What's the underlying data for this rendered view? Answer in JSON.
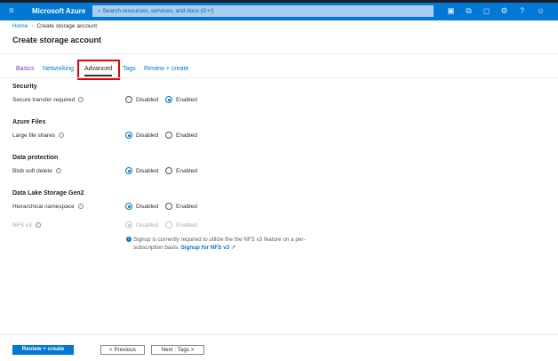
{
  "header": {
    "brand": "Microsoft Azure",
    "search_placeholder": "Search resources, services, and docs (G+/)",
    "icons": [
      "cloud-shell-icon",
      "directory-filter-icon",
      "notifications-icon",
      "settings-icon",
      "help-icon",
      "feedback-icon"
    ]
  },
  "breadcrumb": {
    "home": "Home",
    "current": "Create storage account"
  },
  "page_title": "Create storage account",
  "tabs": [
    {
      "label": "Basics"
    },
    {
      "label": "Networking"
    },
    {
      "label": "Advanced",
      "active": true
    },
    {
      "label": "Tags"
    },
    {
      "label": "Review + create"
    }
  ],
  "sections": {
    "security": {
      "title": "Security",
      "label": "Secure transfer required",
      "selected": "Enabled"
    },
    "azure_files": {
      "title": "Azure Files",
      "label": "Large file shares",
      "selected": "Disabled"
    },
    "data_protection": {
      "title": "Data protection",
      "label": "Blob soft delete",
      "selected": "Disabled"
    },
    "data_lake": {
      "title": "Data Lake Storage Gen2",
      "label": "Hierarchical namespace",
      "selected": "Disabled",
      "nfs_label": "NFS v3",
      "nfs_selected": "Disabled"
    }
  },
  "options": {
    "disabled": "Disabled",
    "enabled": "Enabled"
  },
  "note": {
    "text": "Signup is currently required to utilize the the NFS v3 feature on a per-subscription basis.",
    "link": "Signup for NFS v3"
  },
  "footer": {
    "review": "Review + create",
    "previous": "< Previous",
    "next": "Next : Tags >"
  },
  "colors": {
    "accent": "#0078d4",
    "highlight": "#e00000"
  }
}
